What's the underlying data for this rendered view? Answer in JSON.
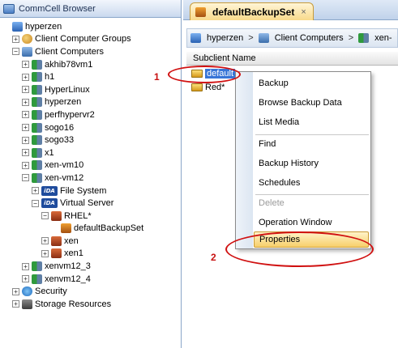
{
  "browser": {
    "title": "CommCell Browser"
  },
  "tree": [
    {
      "label": "hyperzen",
      "expander": "",
      "icon": "commcell-icon"
    },
    {
      "label": "Client Computer Groups",
      "expander": "+",
      "icon": "client-group-icon"
    },
    {
      "label": "Client Computers",
      "expander": "−",
      "icon": "client-computers-icon"
    },
    {
      "label": "akhib78vm1",
      "expander": "+",
      "icon": "client-computer-icon"
    },
    {
      "label": "h1",
      "expander": "+",
      "icon": "client-computer-icon"
    },
    {
      "label": "HyperLinux",
      "expander": "+",
      "icon": "client-computer-icon"
    },
    {
      "label": "hyperzen",
      "expander": "+",
      "icon": "client-computer-icon"
    },
    {
      "label": "perfhypervr2",
      "expander": "+",
      "icon": "client-computer-icon"
    },
    {
      "label": "sogo16",
      "expander": "+",
      "icon": "client-computer-icon"
    },
    {
      "label": "sogo33",
      "expander": "+",
      "icon": "client-computer-icon"
    },
    {
      "label": "x1",
      "expander": "+",
      "icon": "client-computer-icon"
    },
    {
      "label": "xen-vm10",
      "expander": "+",
      "icon": "client-computer-icon"
    },
    {
      "label": "xen-vm12",
      "expander": "−",
      "icon": "client-computer-icon"
    },
    {
      "label": "File System",
      "expander": "+",
      "icon": "ida-icon",
      "badge": "iDA"
    },
    {
      "label": "Virtual Server",
      "expander": "−",
      "icon": "ida-icon",
      "badge": "iDA"
    },
    {
      "label": "RHEL*",
      "expander": "−",
      "icon": "instance-icon"
    },
    {
      "label": "defaultBackupSet",
      "expander": "",
      "icon": "backupset-icon"
    },
    {
      "label": "xen",
      "expander": "+",
      "icon": "instance-icon"
    },
    {
      "label": "xen1",
      "expander": "+",
      "icon": "instance-icon"
    },
    {
      "label": "xenvm12_3",
      "expander": "+",
      "icon": "client-computer-icon"
    },
    {
      "label": "xenvm12_4",
      "expander": "+",
      "icon": "client-computer-icon"
    },
    {
      "label": "Security",
      "expander": "+",
      "icon": "security-icon"
    },
    {
      "label": "Storage Resources",
      "expander": "+",
      "icon": "storage-icon"
    }
  ],
  "tab": {
    "title": "defaultBackupSet",
    "close": "×"
  },
  "breadcrumb": {
    "items": [
      "hyperzen",
      "Client Computers",
      "xen-"
    ],
    "separator": ">"
  },
  "list": {
    "column": "Subclient Name",
    "rows": [
      "default",
      "Red*"
    ]
  },
  "menu": {
    "items": [
      "Backup",
      "Browse Backup Data",
      "List Media",
      "Find",
      "Backup History",
      "Schedules",
      "Delete",
      "Operation Window",
      "Properties"
    ],
    "disabled": [
      "Delete"
    ],
    "highlighted": "Properties"
  },
  "annotations": {
    "step1": "1",
    "step2": "2",
    "color": "#d01010"
  }
}
